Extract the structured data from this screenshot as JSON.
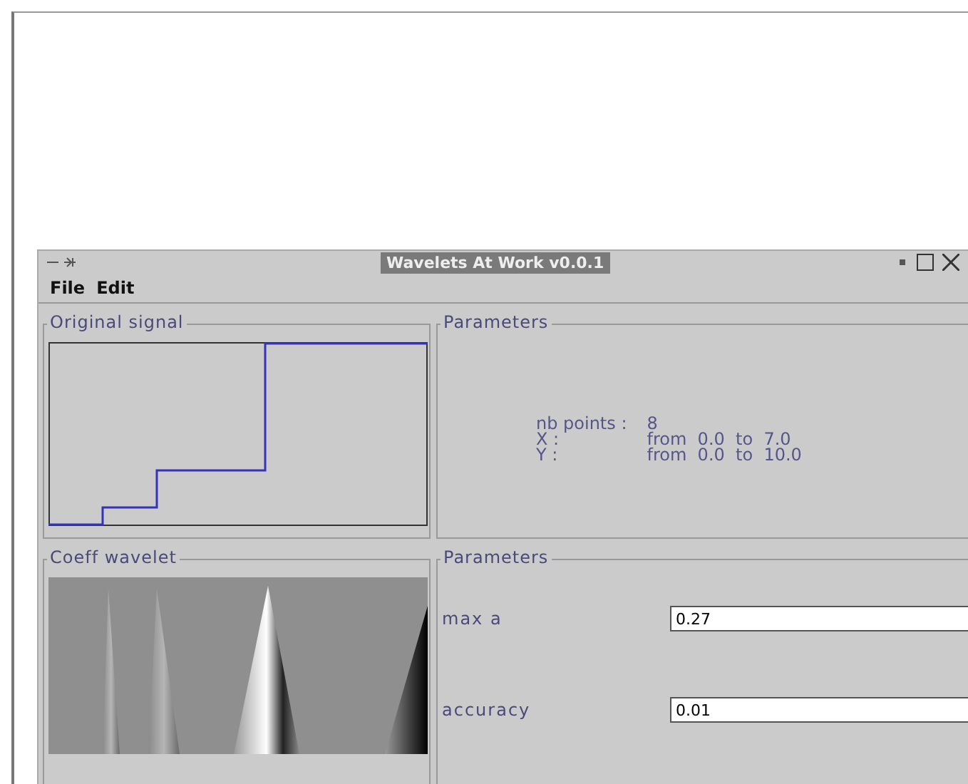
{
  "window": {
    "title": "Wavelets At Work v0.0.1"
  },
  "menu": [
    "File",
    "Edit"
  ],
  "signal_panel": {
    "title": "Original signal"
  },
  "info_panel": {
    "title": "Parameters",
    "rows": [
      {
        "label": "nb points :",
        "value": "8"
      },
      {
        "label": "X :",
        "value": "from  0.0  to  7.0"
      },
      {
        "label": "Y :",
        "value": "from  0.0  to  10.0"
      }
    ]
  },
  "wavelet_panel": {
    "title": "Coeff wavelet"
  },
  "params_panel": {
    "title": "Parameters",
    "fields": [
      {
        "label": "max a",
        "value": "0.27"
      },
      {
        "label": "accuracy",
        "value": "0.01"
      }
    ]
  }
}
